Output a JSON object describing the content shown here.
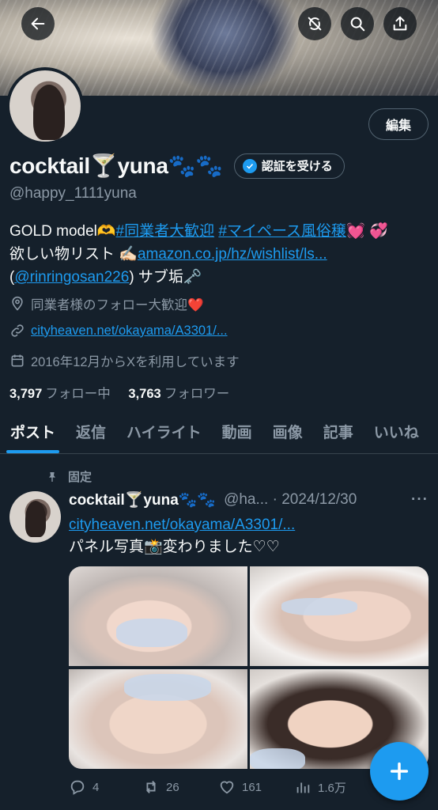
{
  "header": {
    "back_icon": "back-arrow-icon",
    "icons": [
      "translate-icon",
      "search-icon",
      "share-icon"
    ]
  },
  "profile": {
    "edit_label": "編集",
    "display_name": "cocktail🍸yuna🐾🐾",
    "verify_label": "認証を受ける",
    "handle": "@happy_1111yuna",
    "bio_line1_prefix": "GOLD model🫶",
    "bio_hashtag1": "#同業者大歓迎",
    "bio_hashtag2": "#マイペース風俗穣",
    "bio_line1_suffix": "💓 💞",
    "bio_line2_prefix": "欲しい物リスト ✍🏻",
    "bio_link": "amazon.co.jp/hz/wishlist/ls...",
    "bio_line3_open": "(",
    "bio_mention": "@rinringosan226",
    "bio_line3_suffix": ") サブ垢🗝️",
    "location": "同業者様のフォロー大歓迎❤️",
    "website": "cityheaven.net/okayama/A3301/...",
    "joined": "2016年12月からXを利用しています",
    "following_count": "3,797",
    "following_label": "フォロー中",
    "followers_count": "3,763",
    "followers_label": "フォロワー"
  },
  "tabs": [
    "ポスト",
    "返信",
    "ハイライト",
    "動画",
    "画像",
    "記事",
    "いいね"
  ],
  "pinned_tweet": {
    "pinned_label": "固定",
    "name": "cocktail🍸yuna🐾🐾",
    "handle_date": "@ha... · 2024/12/30",
    "more": "···",
    "link": "cityheaven.net/okayama/A3301/...",
    "text": "パネル写真📸変わりました♡♡",
    "replies": "4",
    "reposts": "26",
    "likes": "161",
    "views": "1.6万"
  },
  "colors": {
    "background": "#15202b",
    "accent": "#1d9bf0",
    "muted": "#8b98a5"
  }
}
